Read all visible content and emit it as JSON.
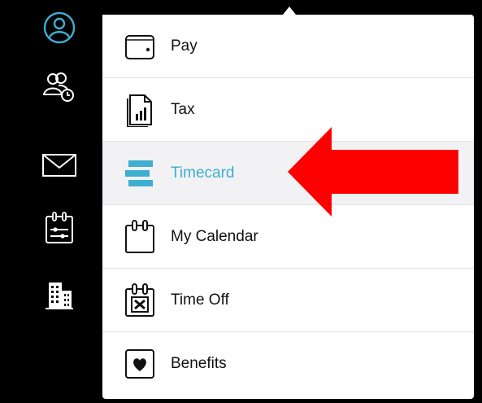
{
  "rail": {
    "icons": [
      "user-profile-icon",
      "people-clock-icon",
      "mail-icon",
      "calendar-settings-icon",
      "building-icon"
    ]
  },
  "menu": {
    "items": [
      {
        "label": "Pay",
        "icon": "wallet-icon"
      },
      {
        "label": "Tax",
        "icon": "tax-document-icon"
      },
      {
        "label": "Timecard",
        "icon": "timecard-icon",
        "active": true
      },
      {
        "label": "My Calendar",
        "icon": "calendar-icon"
      },
      {
        "label": "Time Off",
        "icon": "time-off-icon"
      },
      {
        "label": "Benefits",
        "icon": "heart-icon"
      }
    ]
  },
  "colors": {
    "accent": "#3eaed1",
    "arrow": "#ff0000",
    "active_bg": "#f2f2f4"
  }
}
